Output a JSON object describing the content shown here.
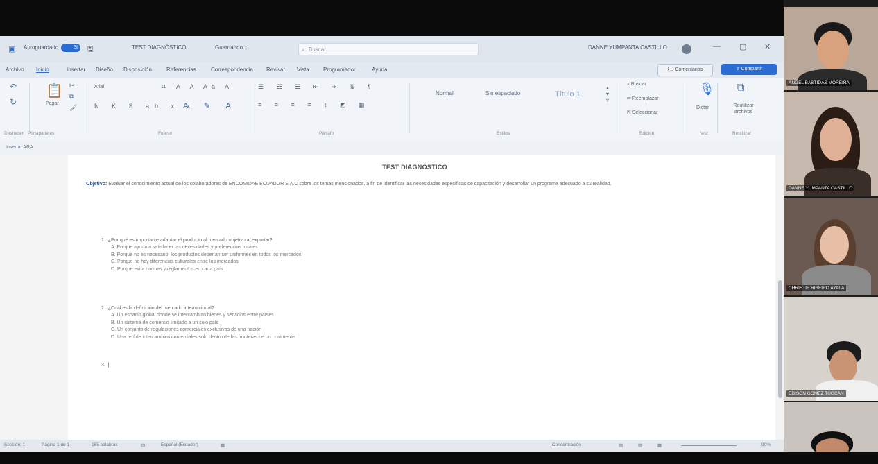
{
  "word": {
    "autosave_label": "Autoguardado",
    "autosave_state": "Sí",
    "doc_name": "TEST DIAGNÓSTICO",
    "saved_state": "Guardando...",
    "search_placeholder": "Buscar",
    "user_name": "DANNE YUMPANTA CASTILLO",
    "menu": [
      "Archivo",
      "Inicio",
      "Insertar",
      "Diseño",
      "Disposición",
      "Referencias",
      "Correspondencia",
      "Revisar",
      "Vista",
      "Programador",
      "Ayuda"
    ],
    "comments_button": "Comentarios",
    "share_button": "Compartir",
    "ribbon": {
      "undo_group": "Deshacer",
      "clipboard_group": "Portapapeles",
      "paste_label": "Pegar",
      "font_name": "Arial",
      "font_size": "11",
      "font_group": "Fuente",
      "paragraph_group": "Párrafo",
      "styles": [
        "Normal",
        "Sin espaciado",
        "Título 1"
      ],
      "styles_group": "Estilos",
      "find": "Buscar",
      "replace": "Reemplazar",
      "select": "Seleccionar",
      "editing_group": "Edición",
      "dictate": "Dictar",
      "voice_group": "Voz",
      "reuse": "Reutilizar archivos",
      "reuse_group": "Reutilizar",
      "insert_file": "Insertar ARA"
    },
    "document": {
      "title": "TEST DIAGNÓSTICO",
      "objective_label": "Objetivo:",
      "objective_text": "Evaluar el conocimiento actual de los colaboradores de ENCOMIDAE ECUADOR S.A.C sobre los temas mencionados, a fin de identificar las necesidades específicas de capacitación y desarrollar un programa adecuado a su realidad.",
      "questions": [
        {
          "number": "1.",
          "text": "¿Por qué es importante adaptar el producto al mercado objetivo al exportar?",
          "options": [
            "A.  Porque ayuda a satisfacer las necesidades y preferencias locales",
            "B.  Porque no es necesario, los productos deberían ser uniformes en todos los mercados",
            "C.  Porque no hay diferencias culturales entre los mercados",
            "D.  Porque evita normas y reglamentos en cada país"
          ]
        },
        {
          "number": "2.",
          "text": "¿Cuál es la definición del mercado internacional?",
          "options": [
            "A.  Un espacio global donde se intercambian bienes y servicios entre países",
            "B.  Un sistema de comercio limitado a un solo país",
            "C.  Un conjunto de regulaciones comerciales exclusivas de una nación",
            "D.  Una red de intercambios comerciales solo dentro de las fronteras de un continente"
          ]
        }
      ],
      "cursor_line": "3."
    },
    "status": {
      "section": "Sección: 1",
      "page": "Página 1 de 1",
      "words": "165 palabras",
      "language": "Español (Ecuador)",
      "focus": "Concentración",
      "zoom": "90%"
    }
  },
  "participants": [
    {
      "name": "ANGEL BASTIDAS MOREIRA",
      "bg": "#b9a89a",
      "skin": "#d9a27e",
      "hair": "#1a1a1a",
      "shirt": "#2a2a2a"
    },
    {
      "name": "DANNE YUMPANTA CASTILLO",
      "bg": "#c7b9ad",
      "skin": "#e0b196",
      "hair": "#2b1d16",
      "shirt": "#3a2e28"
    },
    {
      "name": "CHRISTIE RIBEIRO AYALA",
      "bg": "#6b5a52",
      "skin": "#e6bfa6",
      "hair": "#5a3e2e",
      "shirt": "#8a8a8a"
    },
    {
      "name": "EDISON GOMEZ TUGCAN",
      "bg": "#d8d2cc",
      "skin": "#c99474",
      "hair": "#1c1c1c",
      "shirt": "#f0f0f0"
    },
    {
      "name": "",
      "bg": "#c9c4c0",
      "skin": "#c08a6a",
      "hair": "#111111",
      "shirt": "#ffffff"
    }
  ]
}
